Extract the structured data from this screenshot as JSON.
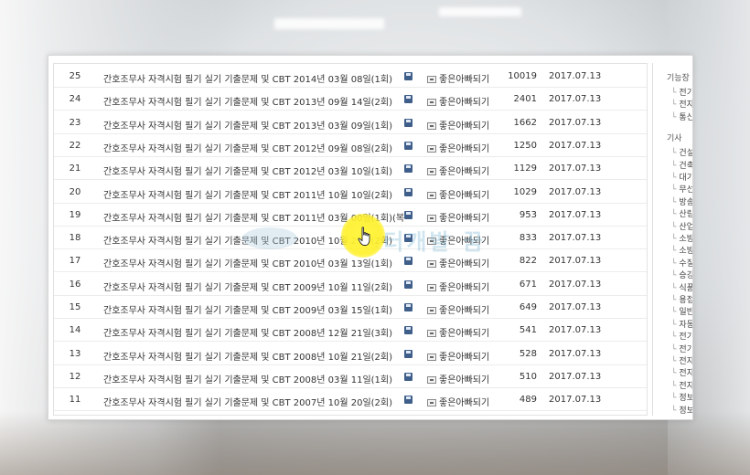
{
  "rows": [
    {
      "num": "25",
      "title": "간호조무사 자격시험 필기 실기 기출문제 및 CBT 2014년 03월 08일(1회)",
      "author": "좋은아빠되기",
      "views": "10019",
      "date": "2017.07.13"
    },
    {
      "num": "24",
      "title": "간호조무사 자격시험 필기 실기 기출문제 및 CBT 2013년 09월 14일(2회)",
      "author": "좋은아빠되기",
      "views": "2401",
      "date": "2017.07.13"
    },
    {
      "num": "23",
      "title": "간호조무사 자격시험 필기 실기 기출문제 및 CBT 2013년 03월 09일(1회)",
      "author": "좋은아빠되기",
      "views": "1662",
      "date": "2017.07.13"
    },
    {
      "num": "22",
      "title": "간호조무사 자격시험 필기 실기 기출문제 및 CBT 2012년 09월 08일(2회)",
      "author": "좋은아빠되기",
      "views": "1250",
      "date": "2017.07.13"
    },
    {
      "num": "21",
      "title": "간호조무사 자격시험 필기 실기 기출문제 및 CBT 2012년 03월 10일(1회)",
      "author": "좋은아빠되기",
      "views": "1129",
      "date": "2017.07.13"
    },
    {
      "num": "20",
      "title": "간호조무사 자격시험 필기 실기 기출문제 및 CBT 2011년 10월 10일(2회)",
      "author": "좋은아빠되기",
      "views": "1029",
      "date": "2017.07.13"
    },
    {
      "num": "19",
      "title": "간호조무사 자격시험 필기 실기 기출문제 및 CBT 2011년 03월 00일(1회)(복...",
      "author": "좋은아빠되기",
      "views": "953",
      "date": "2017.07.13"
    },
    {
      "num": "18",
      "title": "간호조무사 자격시험 필기 실기 기출문제 및 CBT 2010년 10월 23일(2회)",
      "author": "좋은아빠되기",
      "views": "833",
      "date": "2017.07.13"
    },
    {
      "num": "17",
      "title": "간호조무사 자격시험 필기 실기 기출문제 및 CBT 2010년 03월 13일(1회)",
      "author": "좋은아빠되기",
      "views": "822",
      "date": "2017.07.13"
    },
    {
      "num": "16",
      "title": "간호조무사 자격시험 필기 실기 기출문제 및 CBT 2009년 10월 11일(2회)",
      "author": "좋은아빠되기",
      "views": "671",
      "date": "2017.07.13"
    },
    {
      "num": "15",
      "title": "간호조무사 자격시험 필기 실기 기출문제 및 CBT 2009년 03월 15일(1회)",
      "author": "좋은아빠되기",
      "views": "649",
      "date": "2017.07.13"
    },
    {
      "num": "14",
      "title": "간호조무사 자격시험 필기 실기 기출문제 및 CBT 2008년 12월 21일(3회)",
      "author": "좋은아빠되기",
      "views": "541",
      "date": "2017.07.13"
    },
    {
      "num": "13",
      "title": "간호조무사 자격시험 필기 실기 기출문제 및 CBT 2008년 10월 21일(2회)",
      "author": "좋은아빠되기",
      "views": "528",
      "date": "2017.07.13"
    },
    {
      "num": "12",
      "title": "간호조무사 자격시험 필기 실기 기출문제 및 CBT 2008년 03월 11일(1회)",
      "author": "좋은아빠되기",
      "views": "510",
      "date": "2017.07.13"
    },
    {
      "num": "11",
      "title": "간호조무사 자격시험 필기 실기 기출문제 및 CBT 2007년 10월 20일(2회)",
      "author": "좋은아빠되기",
      "views": "489",
      "date": "2017.07.13"
    }
  ],
  "sidebar": {
    "groups": [
      {
        "heading": "기능장",
        "items": [
          "전기기능장",
          "전자기기기능장",
          "통신설비기능장"
        ]
      },
      {
        "heading": "기사",
        "items": [
          "건설안전기사",
          "건축기사",
          "대기환경기사",
          "무선설비기사",
          "방송통신기사",
          "산림기사",
          "산업안전기사",
          "소방설비기사(기",
          "소방설비기사(전",
          "수질환경기사",
          "승강기기사",
          "식품기사",
          "용접기사",
          "일반기계기사",
          "자동차정비기사",
          "전기기사",
          "전기공사기사",
          "전자기사",
          "전자계산기기사",
          "전자계산기조직",
          "정보처리기사",
          "정보통신기사"
        ]
      }
    ]
  },
  "watermark": {
    "text": "..터개발 꿈"
  },
  "colors": {
    "accent": "#3f5f8a",
    "cursor_highlight": "#fff23c"
  }
}
